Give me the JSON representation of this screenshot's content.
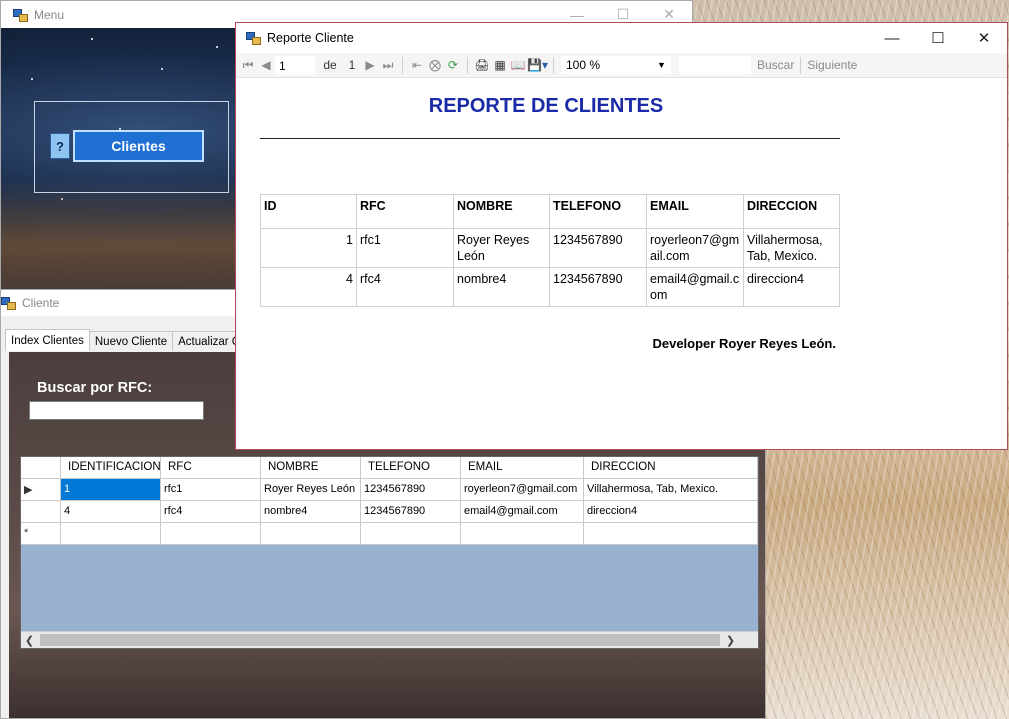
{
  "menu_window": {
    "title": "Menu",
    "help_label": "?",
    "clientes_label": "Clientes"
  },
  "cliente_window": {
    "title": "Cliente",
    "tabs": [
      {
        "label": "Index Clientes"
      },
      {
        "label": "Nuevo Cliente"
      },
      {
        "label": "Actualizar Clie"
      }
    ],
    "search_label": "Buscar por RFC:",
    "search_value": "",
    "grid": {
      "columns": [
        "IDENTIFICACION",
        "RFC",
        "NOMBRE",
        "TELEFONO",
        "EMAIL",
        "DIRECCION"
      ],
      "rows": [
        {
          "marker": "▶",
          "cells": [
            "1",
            "rfc1",
            "Royer Reyes León",
            "1234567890",
            "royerleon7@gmail.com",
            "Villahermosa, Tab, Mexico."
          ]
        },
        {
          "marker": "",
          "cells": [
            "4",
            "rfc4",
            "nombre4",
            "1234567890",
            "email4@gmail.com",
            "direccion4"
          ]
        },
        {
          "marker": "*",
          "cells": [
            "",
            "",
            "",
            "",
            "",
            ""
          ]
        }
      ]
    }
  },
  "report_window": {
    "title": "Reporte Cliente",
    "toolbar": {
      "page": "1",
      "of_label": "de",
      "total_pages": "1",
      "zoom": "100 %",
      "find_label": "Buscar",
      "next_label": "Siguiente"
    },
    "report": {
      "title": "REPORTE DE CLIENTES",
      "headers": [
        "ID",
        "RFC",
        "NOMBRE",
        "TELEFONO",
        "EMAIL",
        "DIRECCION"
      ],
      "rows": [
        [
          "1",
          "rfc1",
          "Royer Reyes León",
          "1234567890",
          "royerleon7@gmail.com",
          "Villahermosa, Tab, Mexico."
        ],
        [
          "4",
          "rfc4",
          "nombre4",
          "1234567890",
          "email4@gmail.com",
          "direccion4"
        ]
      ],
      "footer": "Developer Royer Reyes León."
    }
  },
  "colors": {
    "report_title": "#1b2aa6",
    "report_border": "#b24b5a",
    "clientes_button": "#1f6fd4",
    "grid_empty": "#98b1cf",
    "selection": "#0078d7"
  }
}
